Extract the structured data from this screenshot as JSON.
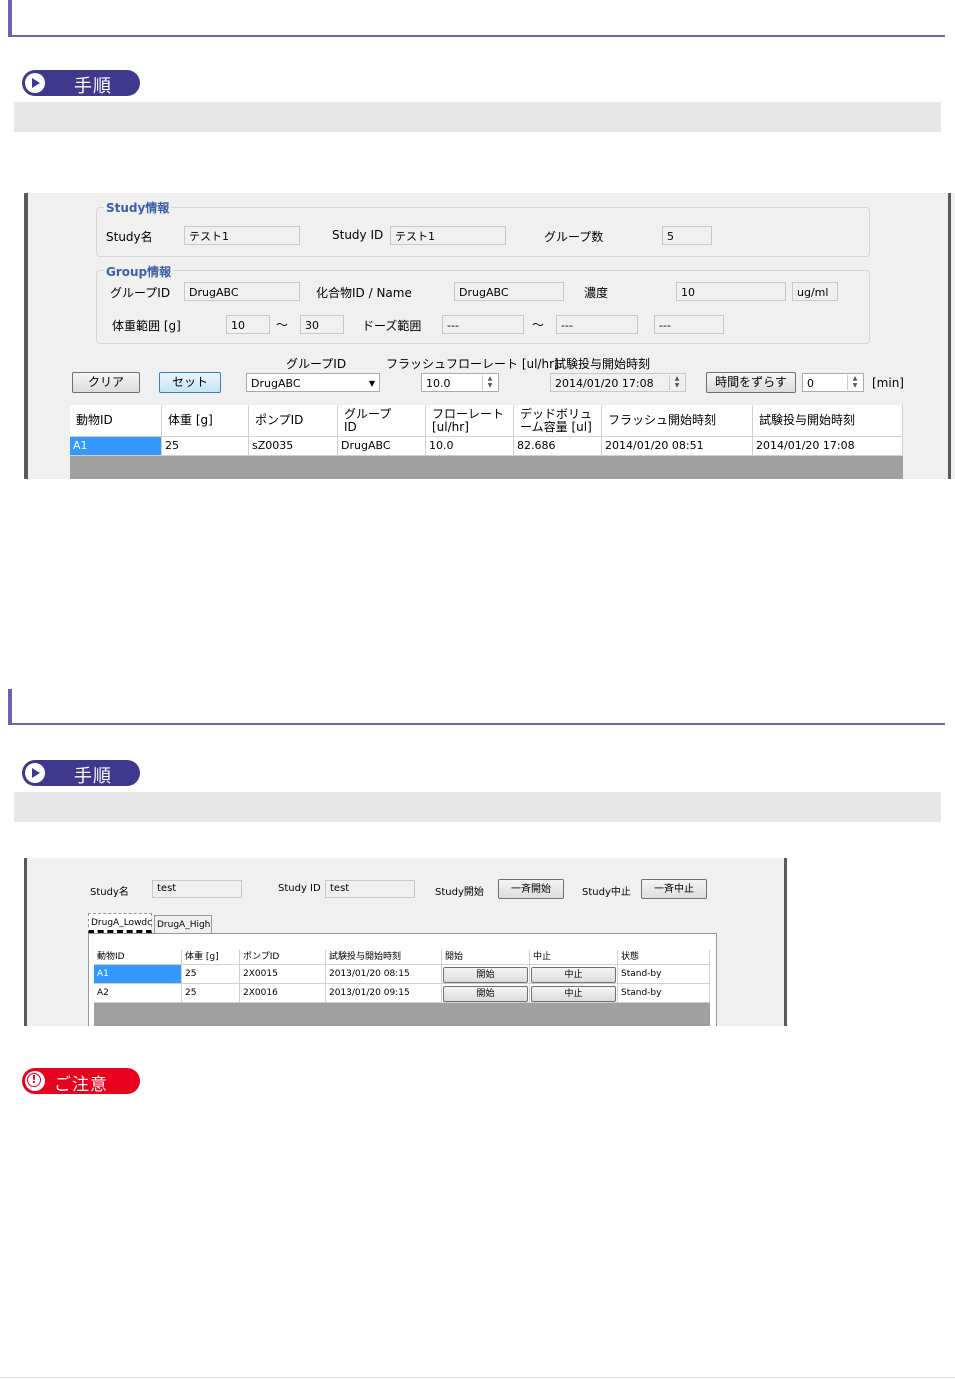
{
  "section1": {
    "procedure_label": "手順",
    "study_info": {
      "legend": "Study情報",
      "study_name_label": "Study名",
      "study_name_value": "テスト1",
      "study_id_label": "Study ID",
      "study_id_value": "テスト1",
      "group_count_label": "グループ数",
      "group_count_value": "5"
    },
    "group_info": {
      "legend": "Group情報",
      "group_id_label": "グループID",
      "group_id_value": "DrugABC",
      "compound_label": "化合物ID / Name",
      "compound_value": "DrugABC",
      "conc_label": "濃度",
      "conc_value": "10",
      "conc_unit": "ug/ml",
      "weight_range_label": "体重範囲 [g]",
      "weight_min": "10",
      "tilde": "～",
      "weight_max": "30",
      "dose_range_label": "ドーズ範囲",
      "dose_min": "---",
      "dose_max": "---",
      "dose_extra": "---"
    },
    "controls": {
      "group_id_header": "グループID",
      "flush_rate_header": "フラッシュフローレート [ul/hr]",
      "dose_start_header": "試験投与開始時刻",
      "clear_button": "クリア",
      "set_button": "セット",
      "group_select": "DrugABC",
      "flush_rate_value": "10.0",
      "dose_start_value": "2014/01/20 17:08",
      "shift_button": "時間をずらす",
      "shift_value": "0",
      "shift_unit": "[min]"
    },
    "table": {
      "headers": [
        "動物ID",
        "体重 [g]",
        "ポンプID",
        "グループ\nID",
        "フローレート\n[ul/hr]",
        "デッドボリュ\nーム容量 [ul]",
        "フラッシュ開始時刻",
        "試験投与開始時刻"
      ],
      "rows": [
        [
          "A1",
          "25",
          "sZ0035",
          "DrugABC",
          "10.0",
          "82.686",
          "2014/01/20 08:51",
          "2014/01/20 17:08"
        ]
      ]
    }
  },
  "section2": {
    "procedure_label": "手順",
    "study_name_label": "Study名",
    "study_name_value": "test",
    "study_id_label": "Study ID",
    "study_id_value": "test",
    "study_start_label": "Study開始",
    "start_all_button": "一斉開始",
    "study_stop_label": "Study中止",
    "stop_all_button": "一斉中止",
    "tabs": [
      "DrugA_Lowdc",
      "DrugA_High"
    ],
    "table": {
      "headers": [
        "動物ID",
        "体重 [g]",
        "ポンプID",
        "試験投与開始時刻",
        "開始",
        "中止",
        "状態"
      ],
      "rows": [
        {
          "id": "A1",
          "weight": "25",
          "pump": "2X0015",
          "time": "2013/01/20 08:15",
          "start": "開始",
          "stop": "中止",
          "status": "Stand-by"
        },
        {
          "id": "A2",
          "weight": "25",
          "pump": "2X0016",
          "time": "2013/01/20 09:15",
          "start": "開始",
          "stop": "中止",
          "status": "Stand-by"
        }
      ]
    }
  },
  "caution_label": "ご注意"
}
